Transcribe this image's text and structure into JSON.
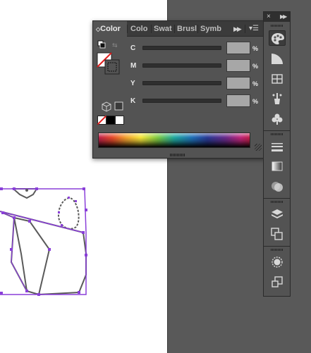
{
  "color_panel": {
    "tabs": [
      {
        "label": "Color",
        "active": true
      },
      {
        "label": "Colo",
        "active": false
      },
      {
        "label": "Swat",
        "active": false
      },
      {
        "label": "Brusl",
        "active": false
      },
      {
        "label": "Symb",
        "active": false
      }
    ],
    "channels": [
      {
        "label": "C",
        "value": "",
        "unit": "%"
      },
      {
        "label": "M",
        "value": "",
        "unit": "%"
      },
      {
        "label": "Y",
        "value": "",
        "unit": "%"
      },
      {
        "label": "K",
        "value": "",
        "unit": "%"
      }
    ],
    "fill_stroke": {
      "fill": "none",
      "stroke": "none"
    },
    "quick_swatches": [
      "none",
      "#000000",
      "#ffffff"
    ]
  },
  "dock": {
    "close_glyph": "×",
    "expand_glyph": "»",
    "tools": [
      {
        "name": "color-palette-icon",
        "active": true
      },
      {
        "name": "color-guide-icon"
      },
      {
        "name": "swatches-icon"
      },
      {
        "name": "brushes-icon"
      },
      {
        "name": "symbols-icon"
      },
      {
        "name": "stroke-icon"
      },
      {
        "name": "gradient-icon"
      },
      {
        "name": "transparency-icon"
      },
      {
        "name": "layers-icon"
      },
      {
        "name": "artboards-icon"
      },
      {
        "name": "appearance-icon"
      },
      {
        "name": "graphic-styles-icon"
      }
    ]
  },
  "colors": {
    "selection": "#8a3fd9",
    "panel_bg": "#535353",
    "canvas_bg": "#595959"
  }
}
